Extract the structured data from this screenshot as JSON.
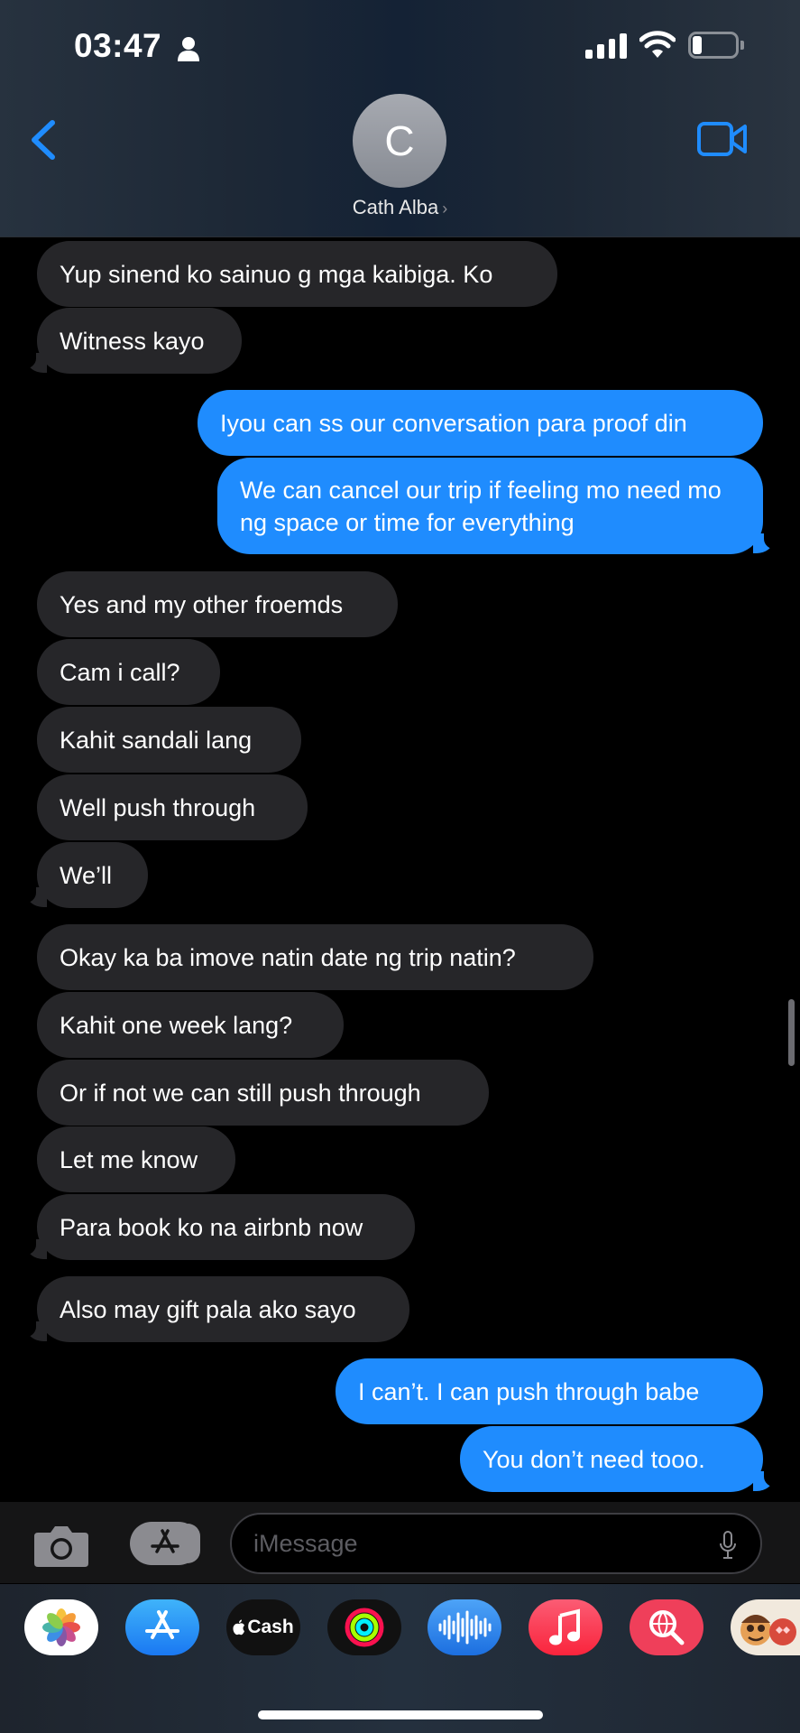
{
  "status_bar": {
    "time": "03:47",
    "icons": [
      "person-icon",
      "signal-icon",
      "wifi-icon",
      "battery-icon"
    ]
  },
  "header": {
    "contact_initial": "C",
    "contact_name": "Cath Alba",
    "chevron": "›",
    "icons": [
      "back-chevron-icon",
      "video-call-icon"
    ],
    "accent_color": "#1f8cfe"
  },
  "messages": [
    {
      "from": "them",
      "text": "Yup sinend ko sainuo g mga kaibiga. Ko"
    },
    {
      "from": "them",
      "text": "Witness kayo"
    },
    {
      "from": "me",
      "text": "Iyou can ss our conversation para proof din"
    },
    {
      "from": "me",
      "text": "We can cancel our trip if feeling mo need mo ng space or time for everything"
    },
    {
      "from": "them",
      "text": "Yes and my other froemds"
    },
    {
      "from": "them",
      "text": "Cam i call?"
    },
    {
      "from": "them",
      "text": "Kahit sandali lang"
    },
    {
      "from": "them",
      "text": "Well push through"
    },
    {
      "from": "them",
      "text": "We’ll"
    },
    {
      "from": "them",
      "text": "Okay ka ba imove natin date ng trip natin?"
    },
    {
      "from": "them",
      "text": "Kahit one week lang?"
    },
    {
      "from": "them",
      "text": "Or if not we can still push through"
    },
    {
      "from": "them",
      "text": "Let me know"
    },
    {
      "from": "them",
      "text": "Para book ko na airbnb now"
    },
    {
      "from": "them",
      "text": "Also may gift pala ako sayo"
    },
    {
      "from": "me",
      "text": "I can’t. I can push through babe"
    },
    {
      "from": "me",
      "text": "You don’t need tooo."
    }
  ],
  "colors": {
    "sent_bubble": "#1f8cfe",
    "received_bubble": "#262629",
    "background": "#000000"
  },
  "composer": {
    "placeholder": "iMessage",
    "value": "",
    "icons": [
      "camera-icon",
      "app-store-icon",
      "microphone-icon"
    ]
  },
  "app_drawer": {
    "apps": [
      {
        "name": "photos-app-icon"
      },
      {
        "name": "app-store-app-icon"
      },
      {
        "name": "apple-cash-app-icon",
        "label": "Cash"
      },
      {
        "name": "activity-app-icon"
      },
      {
        "name": "audio-message-app-icon"
      },
      {
        "name": "music-app-icon"
      },
      {
        "name": "images-search-app-icon"
      },
      {
        "name": "memoji-app-icon"
      }
    ]
  }
}
